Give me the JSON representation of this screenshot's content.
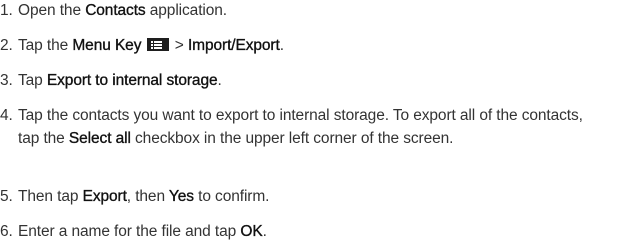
{
  "steps": [
    {
      "number": "1.",
      "pre": "Open the ",
      "bold": "Contacts",
      "post": " application."
    },
    {
      "number": "2.",
      "pre": "Tap the ",
      "bold_menu": "Menu Key",
      "icon": "menu-key-icon",
      "gt": " > ",
      "bold_import": "Import/Export",
      "post": "."
    },
    {
      "number": "3.",
      "pre": "Tap ",
      "bold": "Export to internal storage",
      "post": "."
    },
    {
      "number": "4.",
      "pre": "Tap the contacts you want to export to internal storage. To export all of the contacts, tap the ",
      "bold": "Select all",
      "post": " checkbox in the upper left corner of the screen."
    },
    {
      "number": "5.",
      "pre": "Then tap ",
      "bold_export": "Export",
      "mid": ", then ",
      "bold_yes": "Yes",
      "post": " to confirm."
    },
    {
      "number": "6.",
      "pre": "Enter a name for the file and tap ",
      "bold": "OK",
      "post": "."
    }
  ]
}
